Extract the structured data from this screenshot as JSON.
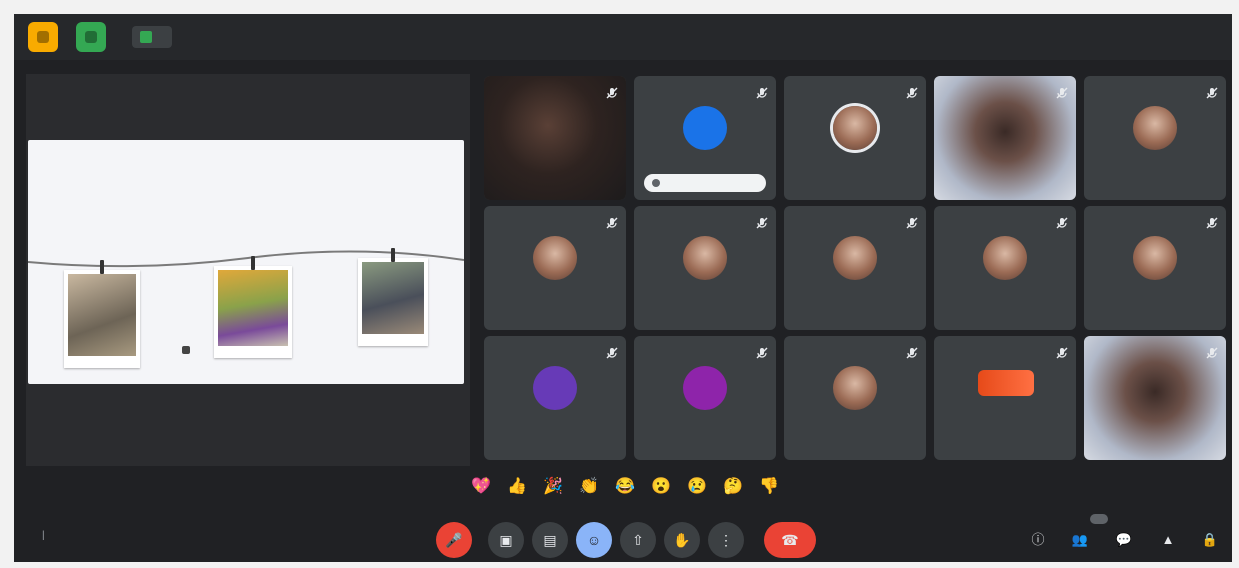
{
  "window": {
    "title": "",
    "colors": {
      "background": "#202124",
      "tile": "#3c4043",
      "end_call": "#ea4335",
      "accent_yellow": "#f9ab00",
      "accent_green": "#34a853"
    }
  },
  "presentation": {
    "slide_title": "",
    "slide_text": ""
  },
  "participants": [
    {
      "name": "",
      "kind": "photo"
    },
    {
      "name": "",
      "kind": "avatar",
      "initial": "",
      "avatar_color": "#1a73e8",
      "chip_text": ""
    },
    {
      "name": "",
      "kind": "avatar-photo"
    },
    {
      "name": "",
      "kind": "video"
    },
    {
      "name": "",
      "kind": "avatar-photo"
    },
    {
      "name": "",
      "kind": "avatar-photo"
    },
    {
      "name": "",
      "kind": "avatar-photo"
    },
    {
      "name": "",
      "kind": "avatar-photo"
    },
    {
      "name": "",
      "kind": "avatar-photo"
    },
    {
      "name": "",
      "kind": "avatar-photo"
    },
    {
      "name": "",
      "kind": "avatar",
      "initial": "",
      "avatar_color": "#673ab7"
    },
    {
      "name": "",
      "kind": "avatar",
      "initial": "",
      "avatar_color": "#8e24aa"
    },
    {
      "name": "",
      "kind": "avatar-photo"
    },
    {
      "name": "",
      "kind": "logo"
    },
    {
      "name": "",
      "kind": "video"
    }
  ],
  "reactions": [
    "💖",
    "👍",
    "🎉",
    "👏",
    "😂",
    "😮",
    "😢",
    "🤔",
    "👎"
  ],
  "footer": {
    "time": "",
    "meeting_code": ""
  },
  "controls": [
    {
      "id": "mic",
      "icon": "mic-off-icon",
      "glyph": "🎤"
    },
    {
      "id": "camera",
      "icon": "camera-icon",
      "glyph": "▣"
    },
    {
      "id": "captions",
      "icon": "captions-icon",
      "glyph": "▤"
    },
    {
      "id": "reactions",
      "icon": "emoji-icon",
      "glyph": "☺"
    },
    {
      "id": "present",
      "icon": "present-icon",
      "glyph": "⇧"
    },
    {
      "id": "raise-hand",
      "icon": "hand-icon",
      "glyph": "✋"
    },
    {
      "id": "more",
      "icon": "more-vert-icon",
      "glyph": "⋮"
    },
    {
      "id": "leave",
      "icon": "end-call-icon",
      "glyph": "☎"
    }
  ],
  "side_controls": [
    {
      "id": "info",
      "icon": "info-icon",
      "glyph": "ⓘ"
    },
    {
      "id": "people",
      "icon": "people-icon",
      "glyph": "👥"
    },
    {
      "id": "chat",
      "icon": "chat-icon",
      "glyph": "💬"
    },
    {
      "id": "activities",
      "icon": "activities-icon",
      "glyph": "▲"
    },
    {
      "id": "host-controls",
      "icon": "lock-icon",
      "glyph": "🔒"
    }
  ]
}
